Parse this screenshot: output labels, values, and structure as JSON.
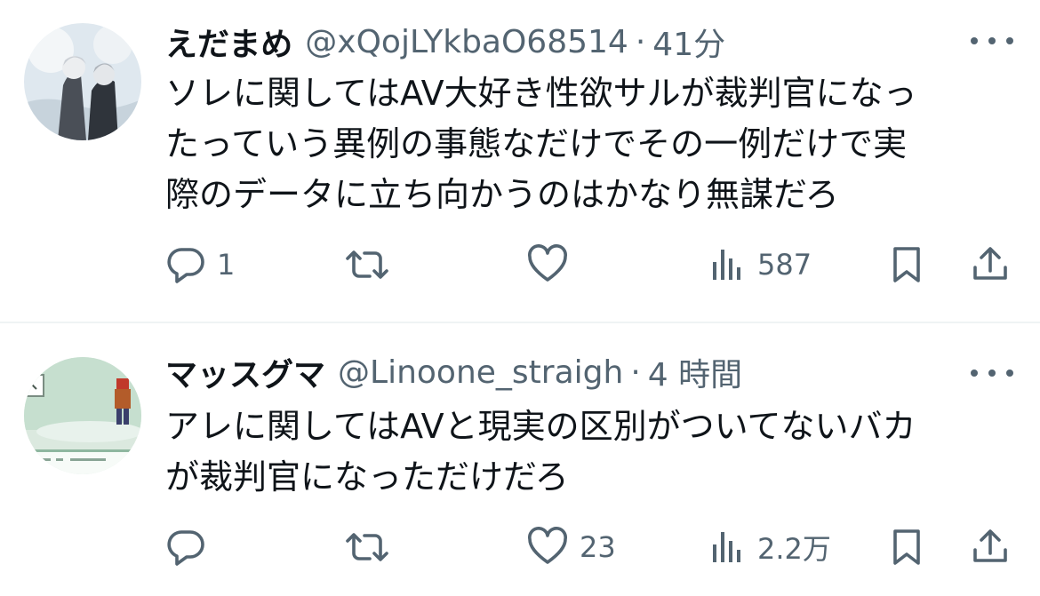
{
  "tweets": [
    {
      "display_name": "えだまめ",
      "handle": "@xQojLYkbaO68514",
      "separator": "·",
      "time": "41分",
      "lines": [
        "ソレに関してはAV大好き性欲サルが裁判官になっ",
        "たっていう異例の事態なだけでその一例だけで実",
        "際のデータに立ち向かうのはかなり無謀だろ"
      ],
      "actions": {
        "replies": "1",
        "retweets": "",
        "likes": "",
        "views": "587"
      }
    },
    {
      "display_name": "マッスグマ",
      "handle": "@Linoone_straigh",
      "separator": "·",
      "time": "4 時間",
      "lines": [
        "アレに関してはAVと現実の区別がついてないバカ",
        "が裁判官になっただけだろ"
      ],
      "actions": {
        "replies": "",
        "retweets": "",
        "likes": "23",
        "views": "2.2万"
      }
    }
  ],
  "icons": {
    "reply": "speech-bubble",
    "retweet": "retweet-arrows",
    "like": "heart",
    "views": "bar-chart",
    "bookmark": "bookmark",
    "share": "share-upload",
    "more": "three-dots"
  },
  "colors": {
    "text": "#0f1419",
    "secondary": "#536471",
    "divider": "#eff3f4"
  }
}
